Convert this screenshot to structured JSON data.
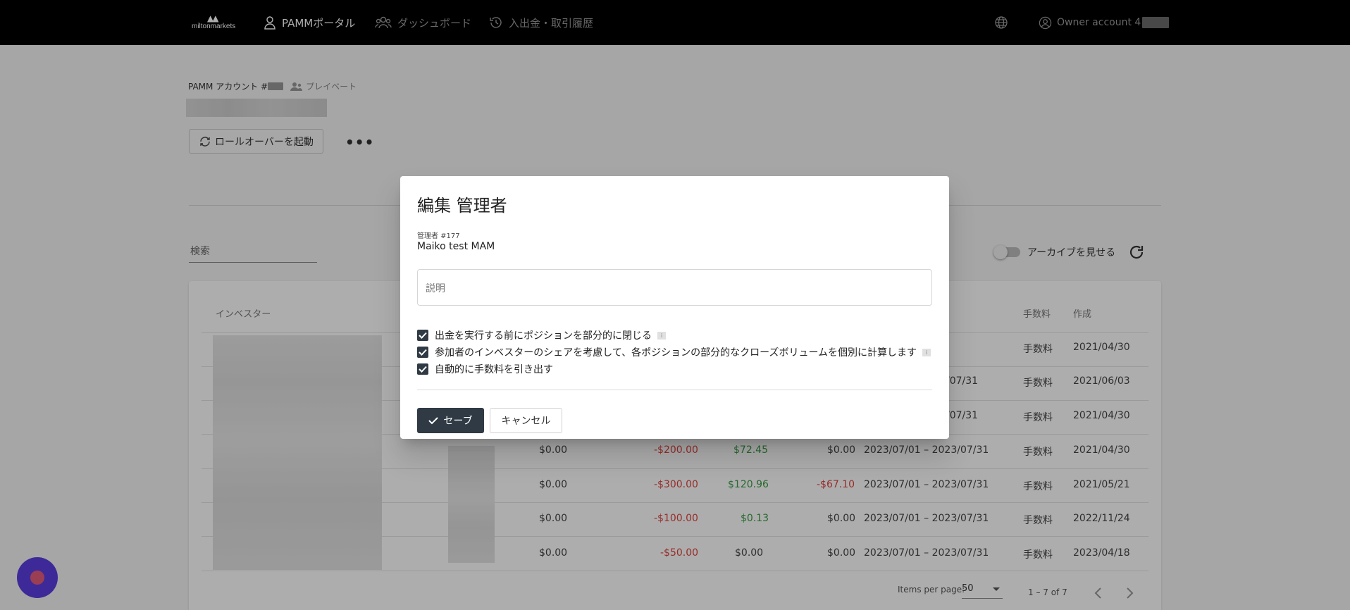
{
  "nav": {
    "logo_text": "miltonmarkets",
    "items": [
      {
        "label": "PAMMポータル",
        "icon": "user-icon"
      },
      {
        "label": "ダッシュボード",
        "icon": "users-icon"
      },
      {
        "label": "入出金・取引履歴",
        "icon": "history-icon"
      }
    ],
    "account_label": "Owner account 4"
  },
  "page": {
    "crumb_prefix": "PAMM アカウント #",
    "private_label": "プレイベート",
    "rollover_label": "ロールオーバーを起動",
    "more_label": "•••",
    "search_placeholder": "検索",
    "archive_label": "アーカイブを見せる"
  },
  "table": {
    "headers": {
      "investor": "インベスター",
      "fee": "手数料",
      "created": "作成"
    },
    "rows": [
      {
        "c1": "",
        "c2": "",
        "c3": "",
        "c4": "",
        "period": "",
        "fee": "手数料",
        "created": "2021/04/30"
      },
      {
        "c1": "",
        "c2": "",
        "c3": "",
        "c4": "",
        "period": "/07/31",
        "fee": "手数料",
        "created": "2021/06/03"
      },
      {
        "c1": "",
        "c2": "",
        "c3": "",
        "c4": "",
        "period": "/07/31",
        "fee": "手数料",
        "created": "2021/04/30"
      },
      {
        "c1": "$0.00",
        "c2": "-$200.00",
        "c3": "$72.45",
        "c4": "$0.00",
        "period": "2023/07/01 – 2023/07/31",
        "fee": "手数料",
        "created": "2021/04/30"
      },
      {
        "c1": "$0.00",
        "c2": "-$300.00",
        "c3": "$120.96",
        "c4": "-$67.10",
        "period": "2023/07/01 – 2023/07/31",
        "fee": "手数料",
        "created": "2021/05/21"
      },
      {
        "c1": "$0.00",
        "c2": "-$100.00",
        "c3": "$0.13",
        "c4": "$0.00",
        "period": "2023/07/01 – 2023/07/31",
        "fee": "手数料",
        "created": "2022/11/24"
      },
      {
        "c1": "$0.00",
        "c2": "-$50.00",
        "c3": "$0.00",
        "c4": "$0.00",
        "period": "2023/07/01 – 2023/07/31",
        "fee": "手数料",
        "created": "2023/04/18"
      }
    ],
    "paginator": {
      "items_per_page_label": "Items per page:",
      "page_size": "50",
      "range": "1 – 7 of 7"
    }
  },
  "dialog": {
    "title": "編集 管理者",
    "manager_label": "管理者 #177",
    "manager_name": "Maiko test MAM",
    "description_placeholder": "説明",
    "options": [
      {
        "label": "出金を実行する前にポジションを部分的に閉じる",
        "checked": true,
        "info": true
      },
      {
        "label": "参加者のインベスターのシェアを考慮して、各ポジションの部分的なクローズボリュームを個別に計算します",
        "checked": true,
        "info": true
      },
      {
        "label": "自動的に手数料を引き出す",
        "checked": true,
        "info": false
      }
    ],
    "save_label": "セーブ",
    "cancel_label": "キャンセル"
  },
  "colors": {
    "primary": "#2f3a44",
    "negative": "#e0433f",
    "positive": "#3a9b45",
    "fab": "#5b3fe0"
  }
}
